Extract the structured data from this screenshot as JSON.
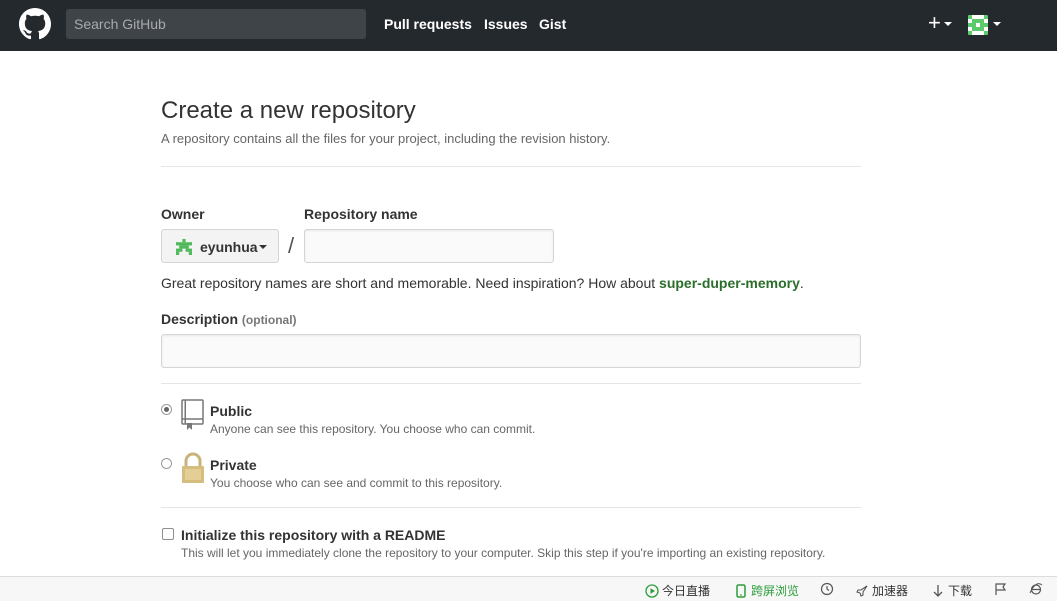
{
  "header": {
    "search_placeholder": "Search GitHub",
    "nav": [
      "Pull requests",
      "Issues",
      "Gist"
    ],
    "new_icon": "plus-icon"
  },
  "page": {
    "title": "Create a new repository",
    "subtitle": "A repository contains all the files for your project, including the revision history."
  },
  "form": {
    "owner_label": "Owner",
    "owner_value": "eyunhua",
    "slash": "/",
    "repo_name_label": "Repository name",
    "repo_name_value": "",
    "hint_prefix": "Great repository names are short and memorable. Need inspiration? How about ",
    "hint_suggestion": "super-duper-memory",
    "hint_suffix": ".",
    "description_label": "Description",
    "description_optional": "(optional)",
    "description_value": "",
    "visibility": [
      {
        "title": "Public",
        "desc": "Anyone can see this repository. You choose who can commit.",
        "selected": true,
        "icon": "repo-book-icon"
      },
      {
        "title": "Private",
        "desc": "You choose who can see and commit to this repository.",
        "selected": false,
        "icon": "lock-icon"
      }
    ],
    "init_readme_label": "Initialize this repository with a README",
    "init_readme_desc": "This will let you immediately clone the repository to your computer. Skip this step if you're importing an existing repository.",
    "init_readme_checked": false
  },
  "statusbar": {
    "items": [
      "今日直播",
      "跨屏浏览",
      "加速器",
      "下载"
    ]
  },
  "colors": {
    "header_bg": "#24292e",
    "suggestion": "#2b6e2b",
    "status_green": "#2a9d3a"
  }
}
